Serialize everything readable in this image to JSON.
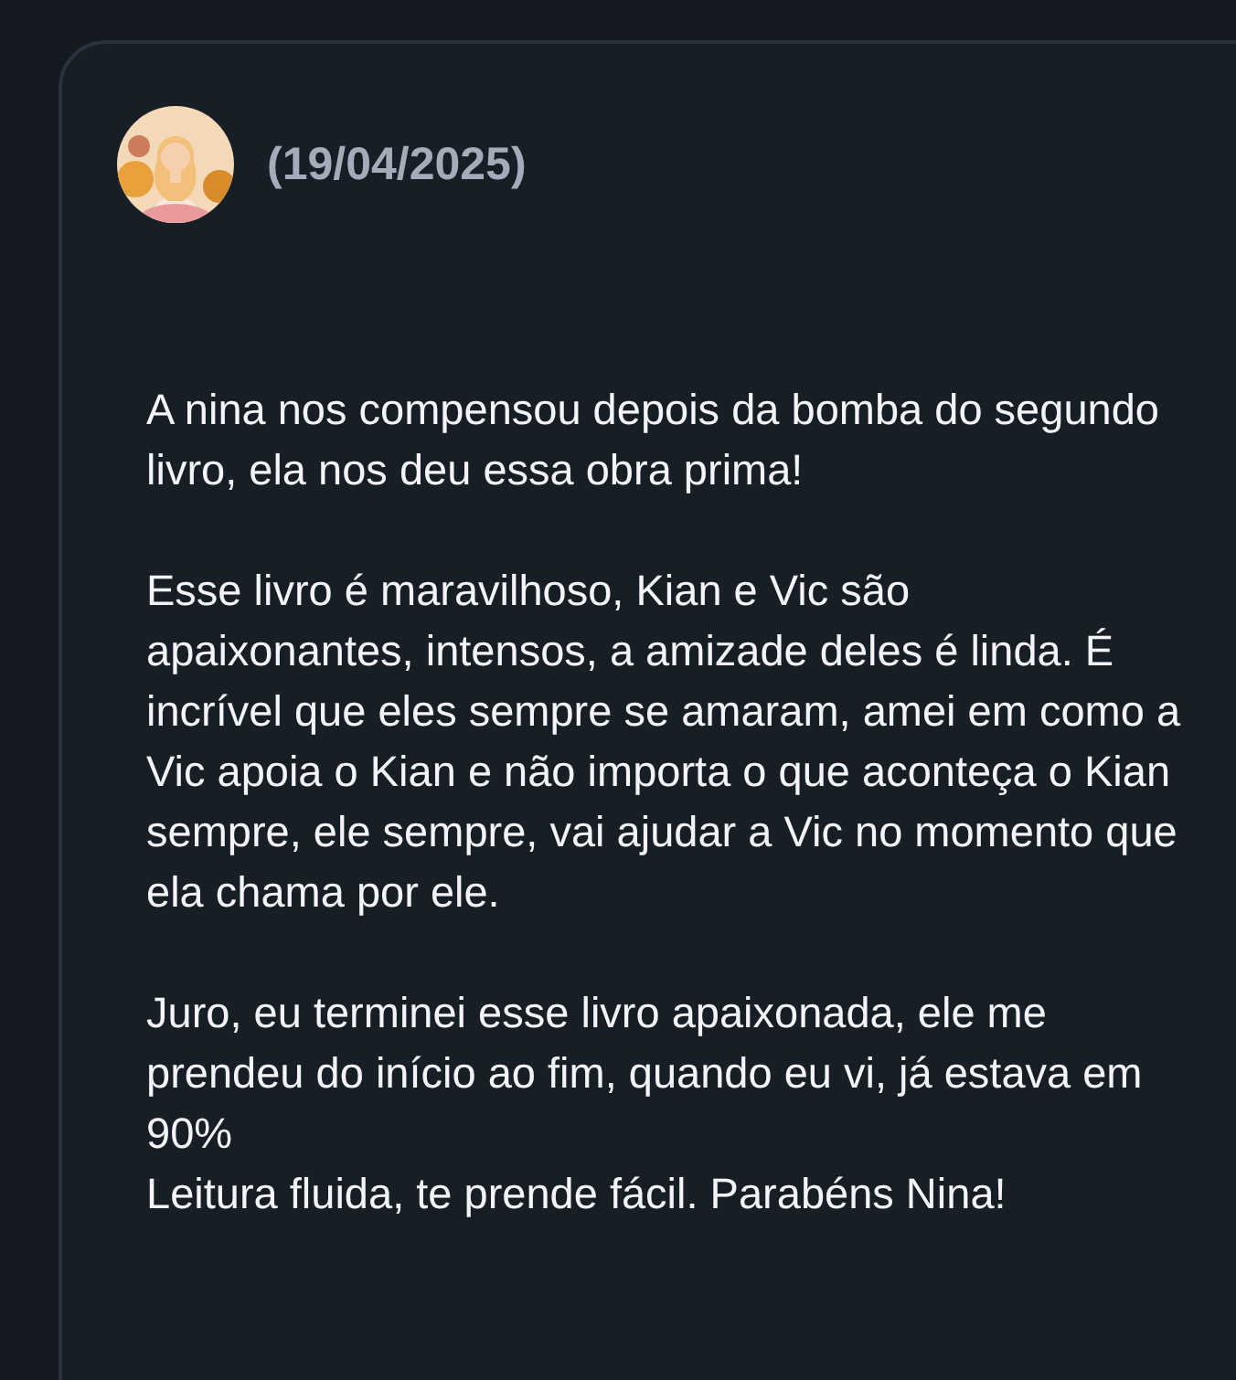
{
  "review": {
    "date": "(19/04/2025)",
    "paragraphs": [
      "A nina nos compensou depois da bomba do segundo livro, ela nos deu essa obra prima!",
      "Esse livro é maravilhoso, Kian e Vic são apaixonantes, intensos, a amizade deles é linda. É incrível que eles sempre se amaram, amei em como a Vic apoia o Kian e não importa o que aconteça o Kian sempre, ele sempre, vai ajudar a Vic no momento que ela chama por ele.",
      "Juro, eu terminei esse livro apaixonada, ele me prendeu do início ao fim, quando eu vi, já estava em 90%\nLeitura fluida, te prende fácil. Parabéns Nina!"
    ]
  }
}
